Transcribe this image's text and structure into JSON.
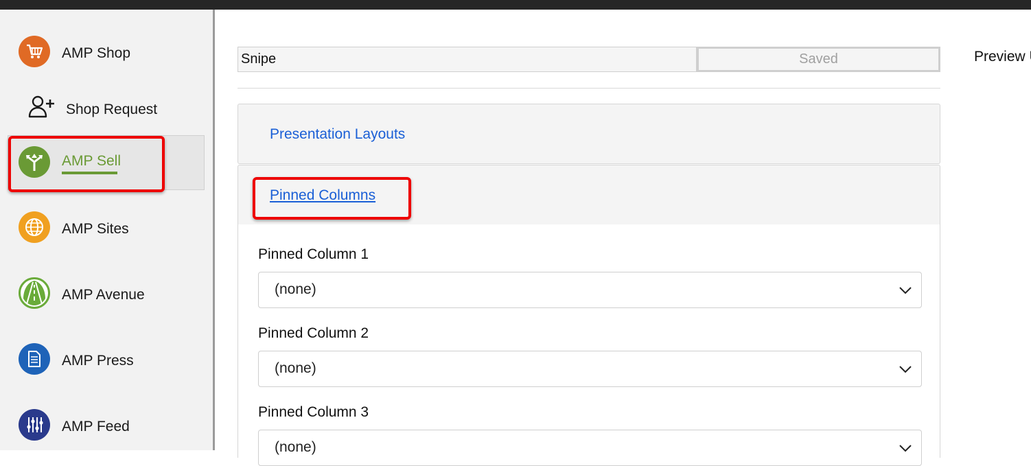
{
  "sidebar": {
    "items": [
      {
        "label": "AMP Shop",
        "icon": "shopping-cart-icon",
        "color": "#e06a25"
      },
      {
        "label": "Shop Request",
        "icon": "add-user-icon",
        "color": "#1a1a1a"
      },
      {
        "label": "AMP Sell",
        "icon": "directions-icon",
        "color": "#6a9a35",
        "active": true
      },
      {
        "label": "AMP Sites",
        "icon": "globe-icon",
        "color": "#f0a020"
      },
      {
        "label": "AMP Avenue",
        "icon": "road-icon",
        "color": "#6aab3a"
      },
      {
        "label": "AMP Press",
        "icon": "document-icon",
        "color": "#1e63b8"
      },
      {
        "label": "AMP Feed",
        "icon": "sliders-icon",
        "color": "#2a3a8c"
      }
    ]
  },
  "toolbar": {
    "name_value": "Snipe",
    "saved_label": "Saved",
    "preview_label": "Preview U"
  },
  "sections": {
    "presentation_layouts": "Presentation Layouts",
    "pinned_columns": "Pinned Columns"
  },
  "pinned_columns": [
    {
      "label": "Pinned Column 1",
      "value": "(none)"
    },
    {
      "label": "Pinned Column 2",
      "value": "(none)"
    },
    {
      "label": "Pinned Column 3",
      "value": "(none)"
    }
  ],
  "colors": {
    "accent_link": "#1a5fd6",
    "active_green": "#6a9a35",
    "highlight_red": "#ee0000"
  }
}
